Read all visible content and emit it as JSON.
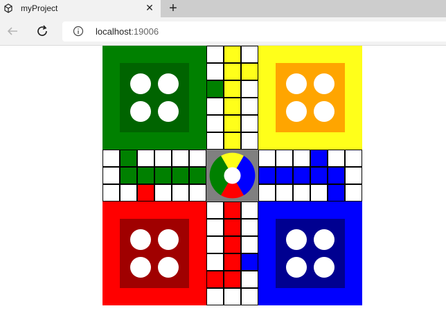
{
  "browser": {
    "tab_title": "myProject",
    "tab_close": "✕",
    "new_tab": "+",
    "url_host": "localhost",
    "url_port": ":19006"
  },
  "icons": [
    "app-icon",
    "close-icon",
    "plus-icon",
    "back-arrow-icon",
    "reload-icon",
    "info-icon"
  ],
  "board": {
    "colors": {
      "green": "#008000",
      "green_dark": "#006400",
      "yellow": "#ffff1a",
      "yellow_dark": "#ffa500",
      "red": "#ff0000",
      "red_dark": "#a00000",
      "blue": "#0000ff",
      "blue_dark": "#000090",
      "center_bg": "#808080"
    },
    "homes": [
      {
        "player": "green",
        "pieces": 4
      },
      {
        "player": "yellow",
        "pieces": 4
      },
      {
        "player": "red",
        "pieces": 4
      },
      {
        "player": "blue",
        "pieces": 4
      }
    ]
  }
}
